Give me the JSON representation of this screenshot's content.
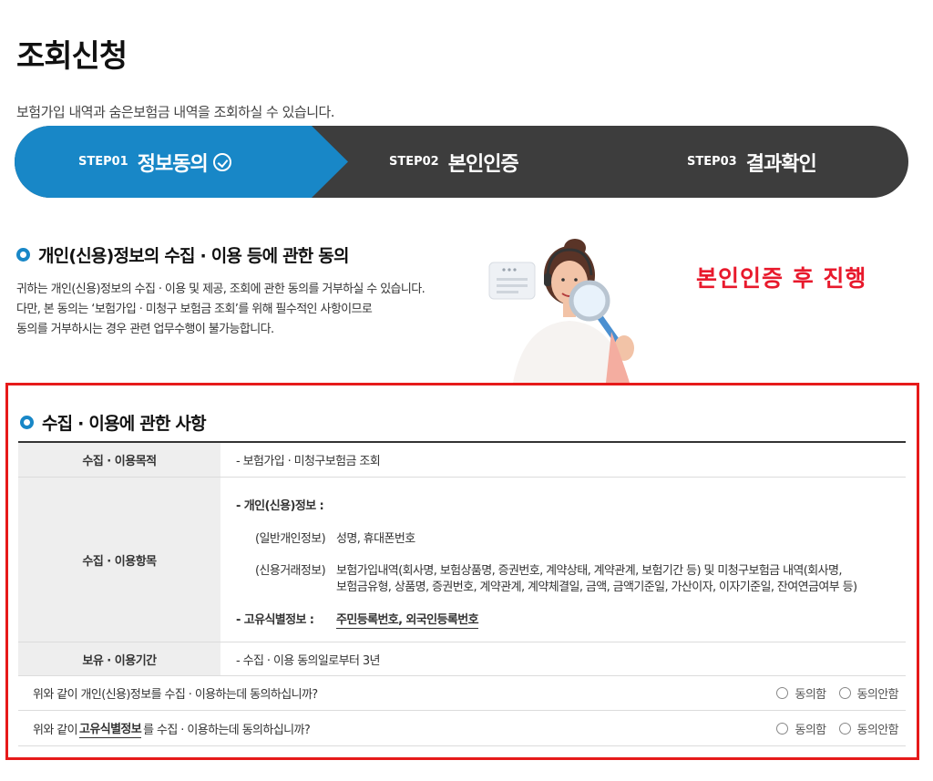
{
  "page": {
    "title": "조회신청",
    "description": "보험가입 내역과 숨은보험금 내역을 조회하실 수 있습니다."
  },
  "steps": [
    {
      "num": "STEP01",
      "label": "정보동의",
      "active": true
    },
    {
      "num": "STEP02",
      "label": "본인인증",
      "active": false
    },
    {
      "num": "STEP03",
      "label": "결과확인",
      "active": false
    }
  ],
  "colors": {
    "accent": "#1887c7",
    "step_bar": "#3d3d3d",
    "highlight": "#e61a1a"
  },
  "consent": {
    "heading": "개인(신용)정보의 수집 · 이용 등에 관한 동의",
    "lines": [
      "귀하는 개인(신용)정보의 수집 · 이용 및 제공, 조회에 관한 동의를 거부하실 수 있습니다.",
      "다만, 본 동의는 ‘보험가입 · 미청구 보험금 조회’를 위해 필수적인 사항이므로",
      "동의를 거부하시는 경우 관련 업무수행이 불가능합니다."
    ]
  },
  "note": "본인인증 후 진행",
  "items": {
    "heading": "수집 · 이용에 관한 사항",
    "purpose_label": "수집 · 이용목적",
    "purpose_value": "- 보험가입 · 미청구보험금 조회",
    "items_label": "수집 · 이용항목",
    "personal_info": "- 개인(신용)정보 :",
    "general_tag": "(일반개인정보)",
    "general_value": "성명, 휴대폰번호",
    "credit_tag": "(신용거래정보)",
    "credit_value_1": "보험가입내역(회사명, 보험상품명, 증권번호, 계약상태, 계약관계, 보험기간 등) 및 미청구보험금 내역(회사명,",
    "credit_value_2": "보험금유형, 상품명, 증권번호, 계약관계, 계약체결일, 금액, 금액기준일, 가산이자, 이자기준일, 잔여연금여부 등)",
    "unique_label": "- 고유식별정보 :",
    "unique_value": "주민등록번호, 외국인등록번호",
    "period_label": "보유 · 이용기간",
    "period_value": "- 수집 · 이용 동의일로부터 3년"
  },
  "questions": [
    {
      "pre": "위와 같이 개인(신용)정보를 수집 · 이용하는데 동의하십니까?",
      "em": "",
      "post": "",
      "agree": "동의함",
      "disagree": "동의안함"
    },
    {
      "pre": "위와 같이 ",
      "em": "고유식별정보",
      "post": "를 수집 · 이용하는데 동의하십니까?",
      "agree": "동의함",
      "disagree": "동의안함"
    }
  ]
}
